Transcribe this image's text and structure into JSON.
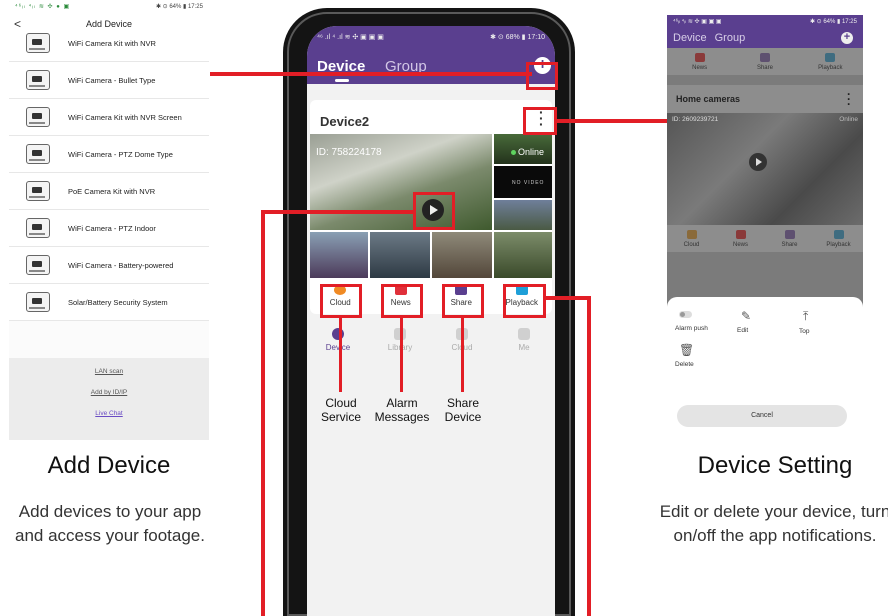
{
  "left_panel": {
    "status_bar": {
      "signal": "⁴⁶ᵢₗ ⁴ᵢₗ ≋ ✣ ● ▣",
      "right": "✱ ⊙ 64% ▮ 17:25"
    },
    "header": {
      "back": "<",
      "title": "Add Device"
    },
    "items": [
      {
        "label": "WiFi Camera Kit with NVR"
      },
      {
        "label": "WiFi Camera - Bullet Type"
      },
      {
        "label": "WiFi Camera Kit with NVR Screen"
      },
      {
        "label": "WiFi Camera - PTZ Dome Type"
      },
      {
        "label": "PoE Camera Kit with NVR"
      },
      {
        "label": "WiFi Camera - PTZ Indoor"
      },
      {
        "label": "WiFi Camera - Battery-powered"
      },
      {
        "label": "Solar/Battery Security System"
      }
    ],
    "footer_links": {
      "lan_scan": "LAN scan",
      "add_by_id": "Add by ID/IP",
      "live_chat": "Live Chat"
    },
    "caption_title": "Add Device",
    "caption_desc": "Add devices to your app and access your footage."
  },
  "phone": {
    "status_bar": {
      "left": "⁴⁶ .ıl ⁴ .ıl ≋ ✣ ▣ ▣ ▣",
      "right": "✱ ⊙ 68% ▮ 17:10"
    },
    "tabs": {
      "device": "Device",
      "group": "Group",
      "add": "+"
    },
    "card": {
      "name": "Device2",
      "id_text": "ID: 758224178",
      "status": "Online",
      "no_video": "NO VIDEO",
      "actions": [
        {
          "label": "Cloud",
          "color": "#f08a24"
        },
        {
          "label": "News",
          "color": "#e0303a"
        },
        {
          "label": "Share",
          "color": "#5a3f8f"
        },
        {
          "label": "Playback",
          "color": "#1e9fd8"
        }
      ]
    },
    "nav": [
      {
        "label": "Device"
      },
      {
        "label": "Library"
      },
      {
        "label": "Cloud"
      },
      {
        "label": "Me"
      }
    ]
  },
  "callouts": {
    "cloud": {
      "line1": "Cloud",
      "line2": "Service"
    },
    "alarm": {
      "line1": "Alarm",
      "line2": "Messages"
    },
    "share": {
      "line1": "Share",
      "line2": "Device"
    }
  },
  "right_panel": {
    "status_bar": {
      "left": "⁴⁶ᵢₗ ⁴ᵢₗ ≋ ✣ ▣ ▣ ▣",
      "right": "✱ ⊙ 64% ▮ 17:25"
    },
    "tabs": {
      "device": "Device",
      "group": "Group",
      "add": "+"
    },
    "top_icons": [
      {
        "label": "News"
      },
      {
        "label": "Share"
      },
      {
        "label": "Playback"
      }
    ],
    "card_title": "Home cameras",
    "id_text": "ID: 2609239721",
    "status": "Online",
    "mid_icons": [
      {
        "label": "Cloud"
      },
      {
        "label": "News"
      },
      {
        "label": "Share"
      },
      {
        "label": "Playback"
      }
    ],
    "sheet": {
      "alarm_push": "Alarm push",
      "edit": "Edit",
      "top": "Top",
      "delete": "Delete",
      "cancel": "Cancel"
    },
    "caption_title": "Device Setting",
    "caption_desc": "Edit or delete your device, turn on/off the app notifications."
  }
}
